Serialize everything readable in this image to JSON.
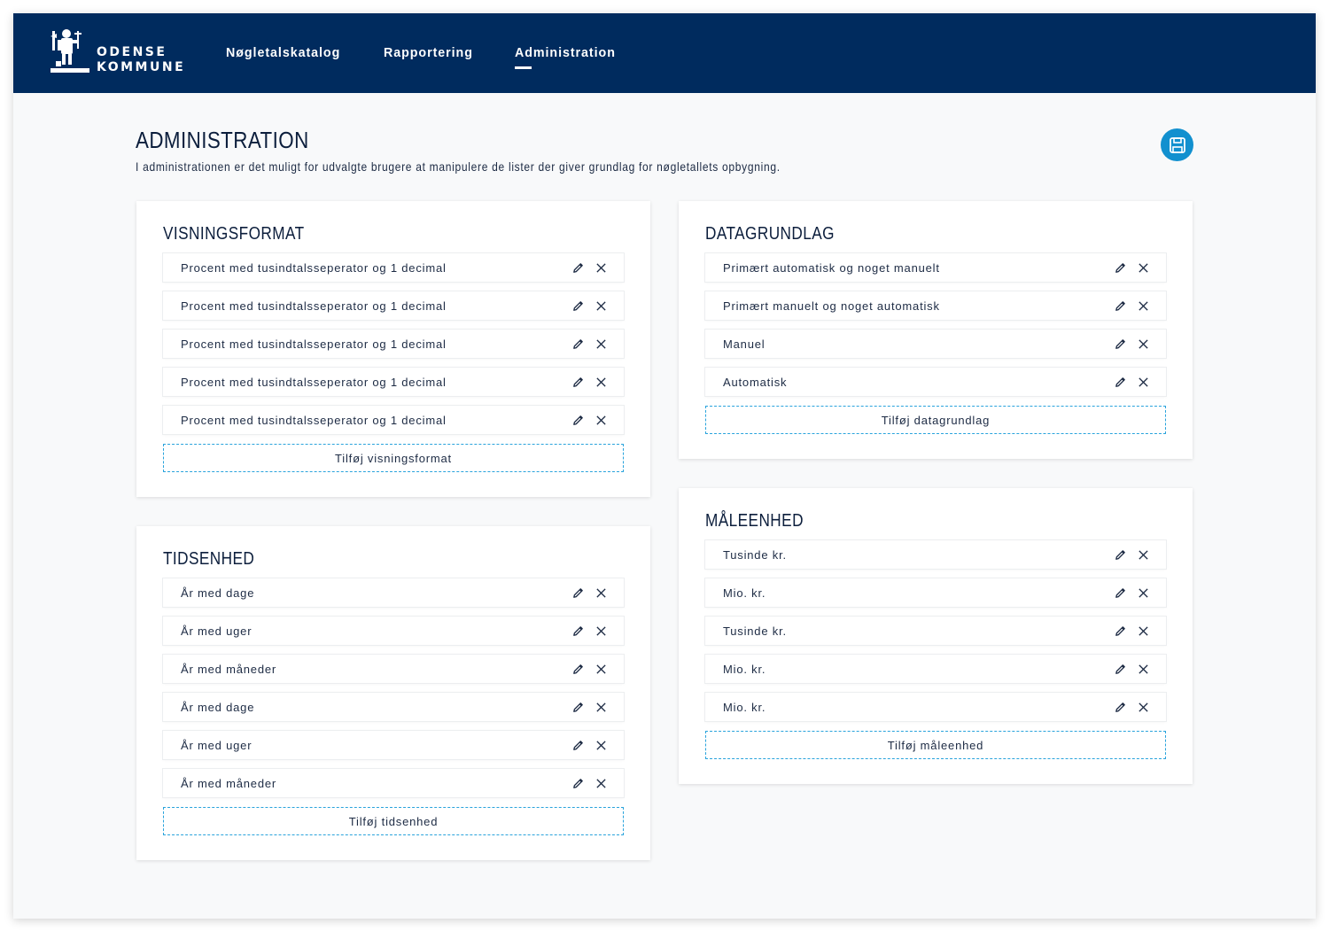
{
  "header": {
    "logo_line1": "ODENSE",
    "logo_line2": "KOMMUNE",
    "nav": [
      {
        "label": "Nøgletalskatalog",
        "active": false
      },
      {
        "label": "Rapportering",
        "active": false
      },
      {
        "label": "Administration",
        "active": true
      }
    ]
  },
  "page": {
    "title": "ADMINISTRATION",
    "description": "I administrationen er det muligt for udvalgte brugere at manipulere de lister der giver grundlag for nøgletallets opbygning.",
    "save_icon": "save-icon"
  },
  "sections": {
    "visningsformat": {
      "title": "VISNINGSFORMAT",
      "items": [
        "Procent med tusindtalsseperator og 1 decimal",
        "Procent med tusindtalsseperator og 1 decimal",
        "Procent med tusindtalsseperator og 1 decimal",
        "Procent med tusindtalsseperator og 1 decimal",
        "Procent med tusindtalsseperator og 1 decimal"
      ],
      "add_label": "Tilføj visningsformat"
    },
    "tidsenhed": {
      "title": "TIDSENHED",
      "items": [
        "År med dage",
        "År med uger",
        "År med måneder",
        "År med dage",
        "År med uger",
        "År med måneder"
      ],
      "add_label": "Tilføj tidsenhed"
    },
    "datagrundlag": {
      "title": "DATAGRUNDLAG",
      "items": [
        "Primært automatisk og noget manuelt",
        "Primært manuelt og noget automatisk",
        "Manuel",
        "Automatisk"
      ],
      "add_label": "Tilføj datagrundlag"
    },
    "maaleenhed": {
      "title": "MÅLEENHED",
      "items": [
        "Tusinde kr.",
        "Mio. kr.",
        "Tusinde kr.",
        "Mio. kr.",
        "Mio. kr."
      ],
      "add_label": "Tilføj måleenhed"
    }
  },
  "icons": {
    "edit": "pencil-icon",
    "delete": "close-icon"
  },
  "colors": {
    "header": "#002b5e",
    "accent": "#1290cf",
    "background": "#f8f9fa",
    "dashed_border": "#29a3dc"
  }
}
